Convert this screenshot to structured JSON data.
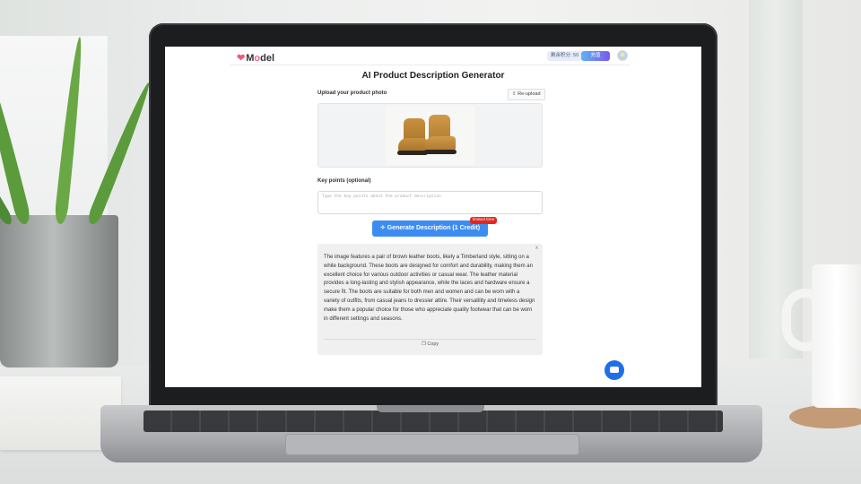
{
  "header": {
    "logo_text_pre": "M",
    "logo_text_o": "o",
    "logo_text_post": "del",
    "credit_text": "剩余积分: 50",
    "vip_label": "充值"
  },
  "page": {
    "title": "AI Product Description Generator"
  },
  "upload": {
    "label": "Upload your product photo",
    "reupload_label": "Re-upload"
  },
  "key_points": {
    "label": "Key points (optional)",
    "placeholder": "Type the key points about the product description"
  },
  "generate": {
    "button_label": "Generate Description (1 Credit)",
    "badge": "limited time"
  },
  "result": {
    "close": "x",
    "text": "The image features a pair of brown leather boots, likely a Timberland style, sitting on a white background. These boots are designed for comfort and durability, making them an excellent choice for various outdoor activities or casual wear. The leather material provides a long-lasting and stylish appearance, while the laces and hardware ensure a secure fit. The boots are suitable for both men and women and can be worn with a variety of outfits, from casual jeans to dressier attire. Their versatility and timeless design make them a popular choice for those who appreciate quality footwear that can be worn in different settings and seasons.",
    "copy_label": "Copy"
  },
  "colors": {
    "primary": "#3c8cf2",
    "badge": "#e4271e",
    "brand_pink": "#f25a7a",
    "chat": "#1f6fe8"
  },
  "icons": [
    "heart-logo-icon",
    "upload-icon",
    "sparkle-icon",
    "copy-icon",
    "chat-icon"
  ]
}
